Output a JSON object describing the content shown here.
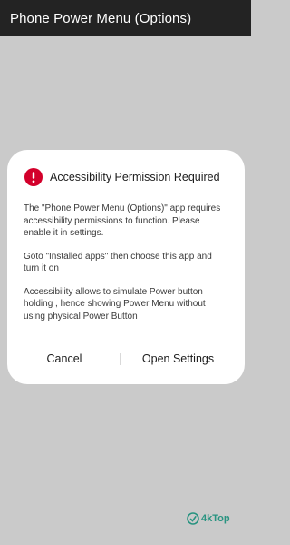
{
  "app_bar": {
    "title": "Phone Power Menu (Options)"
  },
  "dialog": {
    "icon": "alert-circle-icon",
    "title": "Accessibility Permission Required",
    "paragraphs": [
      "The \"Phone Power Menu (Options)\" app requires accessibility permissions to function. Please enable it in settings.",
      "Goto \"Installed apps\" then choose this app and turn it on",
      "Accessibility allows to simulate Power button holding , hence showing Power Menu without using physical Power Button"
    ],
    "cancel_label": "Cancel",
    "open_settings_label": "Open Settings"
  },
  "watermark": {
    "text": "4kTop"
  },
  "colors": {
    "app_bar": "#232323",
    "backdrop": "#cacaca",
    "dialog": "#ffffff",
    "alert": "#d3002b"
  }
}
